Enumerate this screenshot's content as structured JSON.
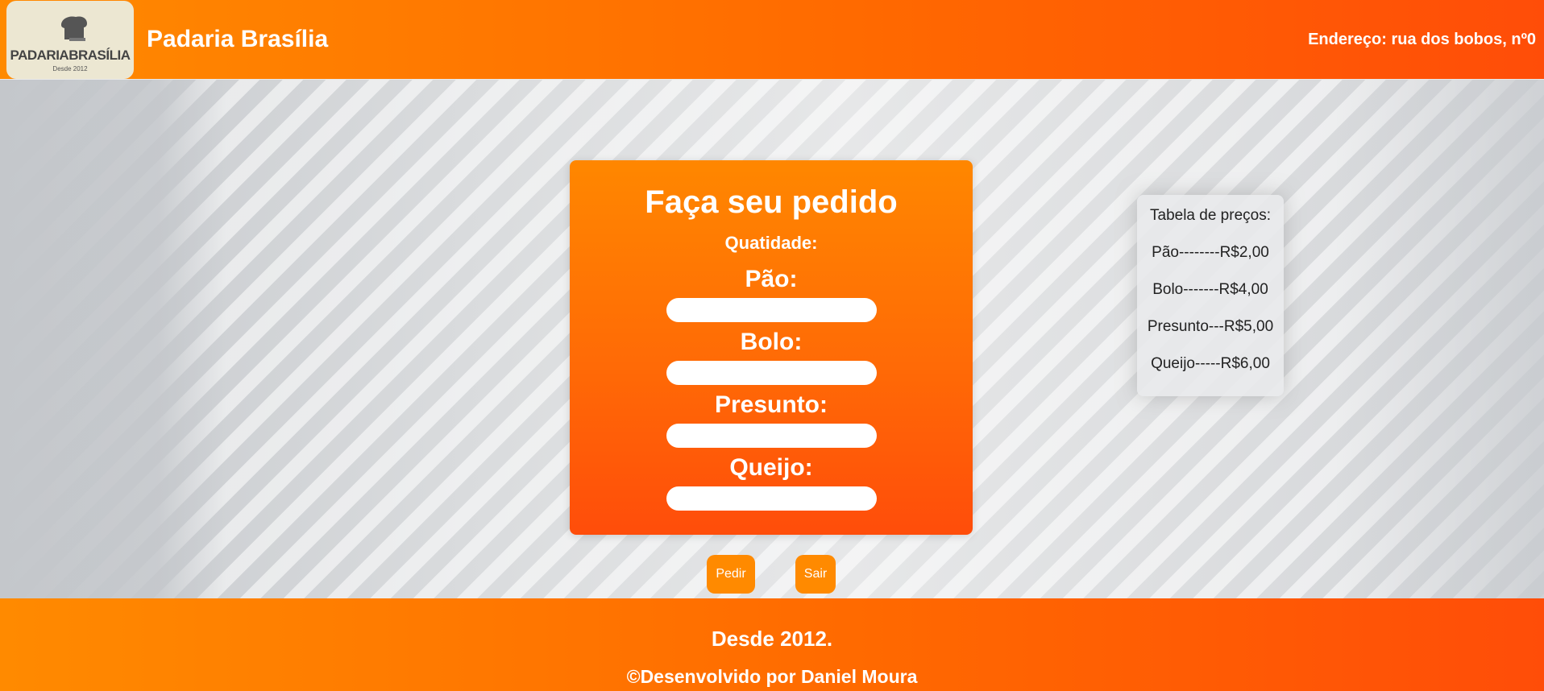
{
  "header": {
    "logo_text": "PADARIABRASÍLIA",
    "logo_sub": "Desde 2012",
    "title": "Padaria Brasília",
    "address": "Endereço: rua dos bobos, nº0"
  },
  "order_form": {
    "title": "Faça seu pedido",
    "subtitle": "Quatidade:",
    "fields": [
      {
        "label": "Pão:",
        "value": ""
      },
      {
        "label": "Bolo:",
        "value": ""
      },
      {
        "label": "Presunto:",
        "value": ""
      },
      {
        "label": "Queijo:",
        "value": ""
      }
    ]
  },
  "buttons": {
    "order_label": "Pedir",
    "exit_label": "Sair"
  },
  "price_table": {
    "title": "Tabela de preços:",
    "rows": [
      "Pão--------R$2,00",
      "Bolo-------R$4,00",
      "Presunto---R$5,00",
      "Queijo-----R$6,00"
    ]
  },
  "footer": {
    "line1": "Desde 2012.",
    "line2": "©Desenvolvido por Daniel Moura"
  },
  "colors": {
    "accent": "#ff6a00",
    "accent_light": "#ff8a00",
    "accent_dark": "#ff4d08"
  }
}
